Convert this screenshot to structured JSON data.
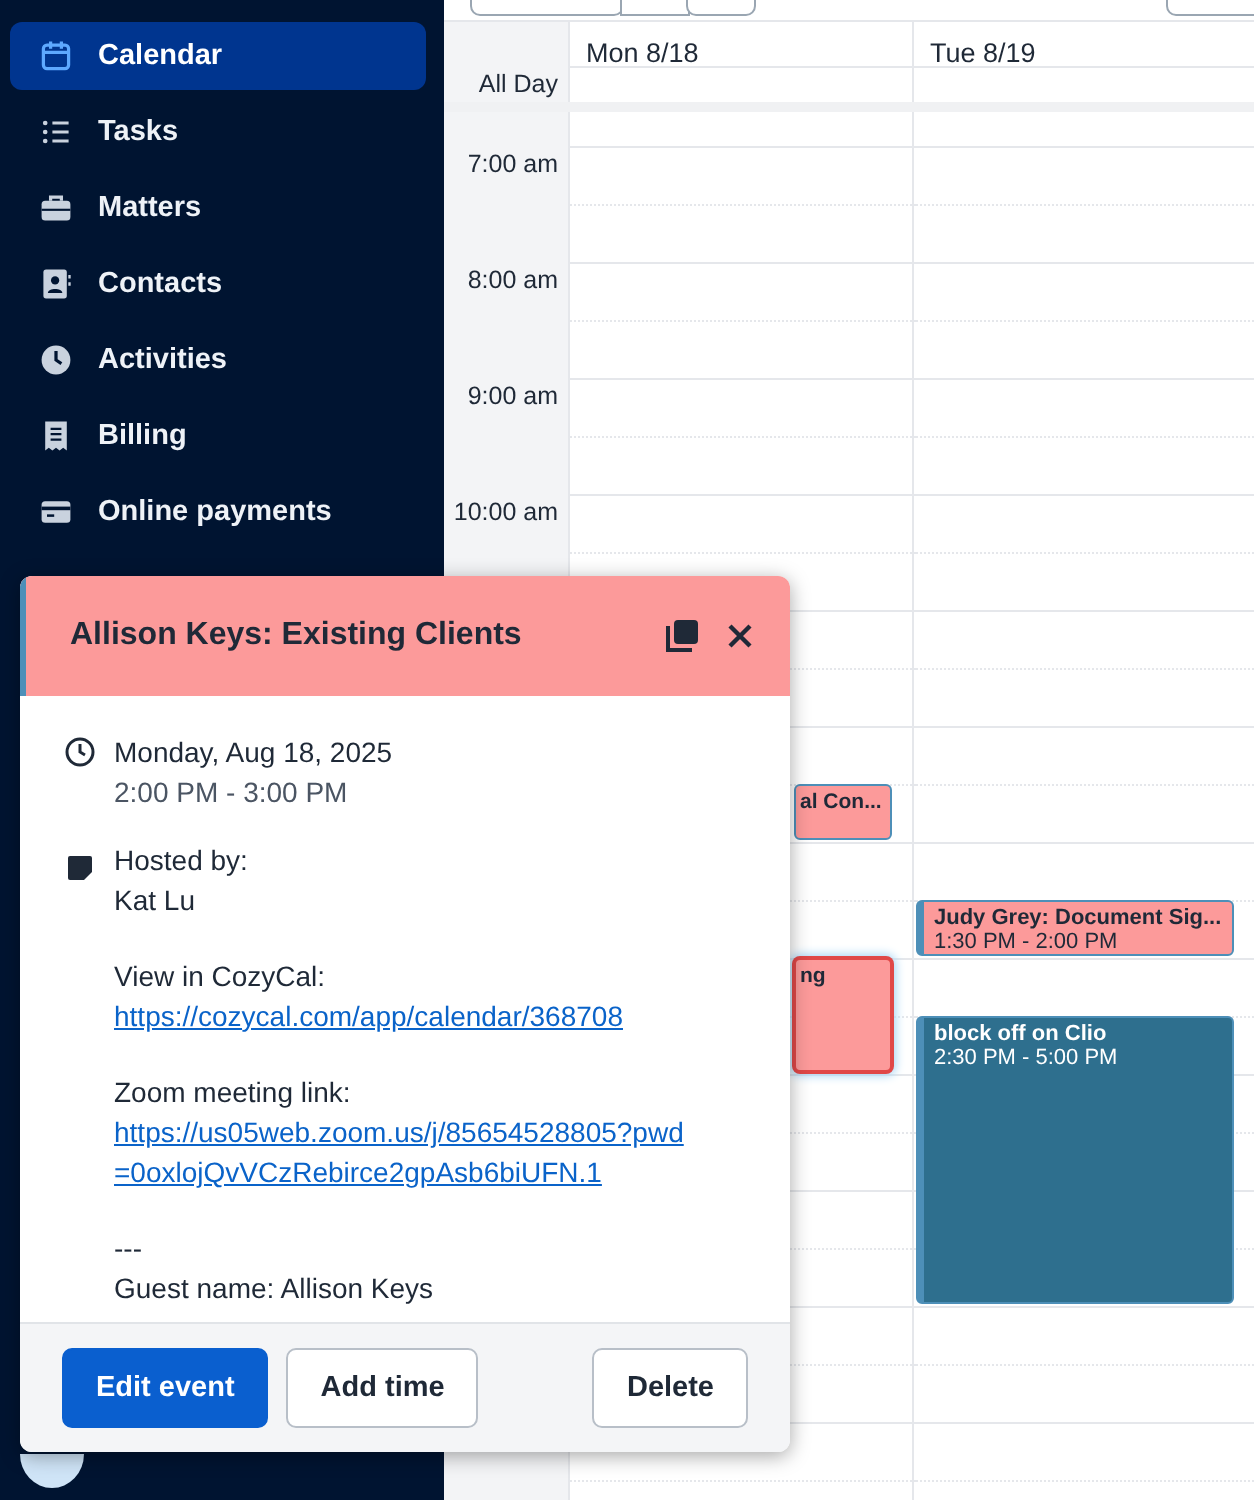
{
  "sidebar": {
    "items": [
      {
        "label": "Calendar",
        "kind": "calendar",
        "selected": true
      },
      {
        "label": "Tasks",
        "kind": "list",
        "selected": false
      },
      {
        "label": "Matters",
        "kind": "briefcase",
        "selected": false
      },
      {
        "label": "Contacts",
        "kind": "contact",
        "selected": false
      },
      {
        "label": "Activities",
        "kind": "clock",
        "selected": false
      },
      {
        "label": "Billing",
        "kind": "receipt",
        "selected": false
      },
      {
        "label": "Online payments",
        "kind": "card",
        "selected": false
      }
    ]
  },
  "calendar": {
    "all_day_label": "All Day",
    "times": [
      "7:00 am",
      "8:00 am",
      "9:00 am",
      "10:00 am"
    ],
    "days": [
      {
        "label": "Mon 8/18",
        "events": [
          {
            "title": "al Con...",
            "color": "#fc9a9a",
            "selected": false
          },
          {
            "title": "ng",
            "color": "#fc9a9a",
            "selected": true
          }
        ]
      },
      {
        "label": "Tue 8/19",
        "events": [
          {
            "title": "Judy Grey: Document Sig...",
            "time": "1:30 PM - 2:00 PM",
            "color": "#fc9a9a",
            "selected": false
          },
          {
            "title": "block off on Clio",
            "time": "2:30 PM - 5:00 PM",
            "color": "#2e6f8e",
            "selected": false
          }
        ]
      }
    ]
  },
  "popup": {
    "title": "Allison Keys: Existing Clients",
    "date": "Monday, Aug 18, 2025",
    "time": "2:00 PM - 3:00 PM",
    "blocks": [
      {
        "lines": [
          {
            "kind": "text",
            "text": "Hosted by:"
          },
          {
            "kind": "text",
            "text": "Kat Lu"
          }
        ]
      },
      {
        "lines": [
          {
            "kind": "text",
            "text": "View in CozyCal:"
          },
          {
            "kind": "link",
            "text": "https://cozycal.com/app/calendar/368708"
          }
        ]
      },
      {
        "lines": [
          {
            "kind": "text",
            "text": "Zoom meeting link:"
          },
          {
            "kind": "link",
            "text": "https://us05web.zoom.us/j/85654528805?pwd=0oxlojQvVCzRebirce2gpAsb6biUFN.1"
          }
        ]
      },
      {
        "lines": [
          {
            "kind": "text",
            "text": "---"
          },
          {
            "kind": "text",
            "text": "Guest name: Allison Keys"
          }
        ]
      }
    ],
    "buttons": [
      {
        "label": "Edit event",
        "kind": "primary"
      },
      {
        "label": "Add time",
        "kind": "secondary"
      },
      {
        "label": "Delete",
        "kind": "secondary"
      }
    ]
  }
}
